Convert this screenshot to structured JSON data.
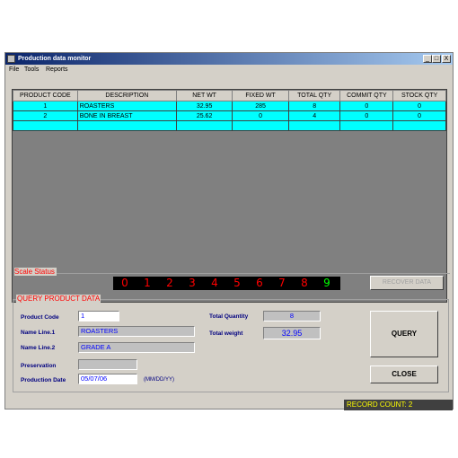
{
  "window": {
    "title": "Production data monitor",
    "controls": [
      "_",
      "□",
      "X"
    ]
  },
  "menu": {
    "items": [
      "File",
      "Tools",
      "Reports"
    ]
  },
  "grid": {
    "columns": [
      "PRODUCT CODE",
      "DESCRIPTION",
      "NET WT",
      "FIXED WT",
      "TOTAL QTY",
      "COMMIT QTY",
      "STOCK QTY"
    ],
    "rows": [
      [
        "1",
        "ROASTERS",
        "32.95",
        "285",
        "8",
        "0",
        "0"
      ],
      [
        "2",
        "BONE IN BREAST",
        "25.62",
        "0",
        "4",
        "0",
        "0"
      ],
      [
        "",
        "",
        "",
        "",
        "",
        "",
        ""
      ]
    ]
  },
  "scale": {
    "label": "Scale Status",
    "digits": [
      "0",
      "1",
      "2",
      "3",
      "4",
      "5",
      "6",
      "7",
      "8",
      "9"
    ],
    "digit_colors": [
      "#ff0000",
      "#ff0000",
      "#ff0000",
      "#ff0000",
      "#ff0000",
      "#ff0000",
      "#ff0000",
      "#ff0000",
      "#ff0000",
      "#00ff00"
    ],
    "recover_label": "RECOVER DATA"
  },
  "query": {
    "title": "QUERY PRODUCT DATA",
    "product_code_label": "Product Code",
    "product_code": "1",
    "name_line1_label": "Name Line.1",
    "name_line1": "ROASTERS",
    "name_line2_label": "Name Line.2",
    "name_line2": "GRADE A",
    "preservation_label": "Preservation",
    "preservation": "",
    "production_date_label": "Production Date",
    "production_date": "05/07/06",
    "date_hint": "(MM/DD/YY)",
    "total_quantity_label": "Total Quantity",
    "total_quantity": "8",
    "total_weight_label": "Total weight",
    "total_weight": "32.95",
    "query_button": "QUERY",
    "close_button": "CLOSE"
  },
  "status": {
    "record_count": "RECORD COUNT: 2"
  }
}
